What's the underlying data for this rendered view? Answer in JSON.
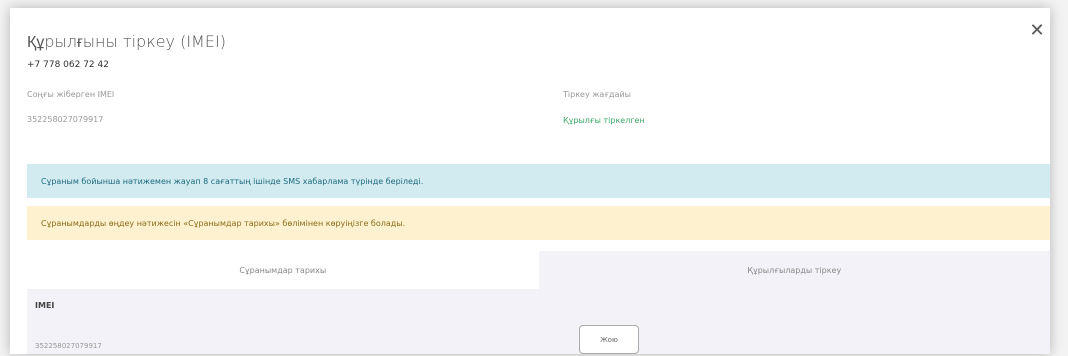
{
  "modal": {
    "title": "Құрылғыны тіркеу (IMEI)",
    "close_glyph": "✕",
    "phone": "+7 778 062 72 42"
  },
  "info": {
    "last_imei_label": "Соңғы жіберген IMEI",
    "last_imei_value": "352258027079917",
    "reg_status_label": "Тіркеу жағдайы",
    "reg_status_value": "Құрылғы тіркелген"
  },
  "alerts": {
    "info_text": "Сұраным бойынша нәтижемен жауап 8 сағаттың ішінде SMS хабарлама түрінде беріледі.",
    "warning_text": "Сұранымдарды өңдеу нәтижесін «Сұранымдар тарихы» бөлімінен көруіңізге болады."
  },
  "tabs": [
    {
      "label": "Сұранымдар тарихы",
      "active": false
    },
    {
      "label": "Құрылғыларды тіркеу",
      "active": true
    }
  ],
  "panel": {
    "imei_header": "IMEI",
    "imei_value": "352258027079917",
    "button_label": "Жою"
  },
  "colors": {
    "info_bg": "#d2ebf1",
    "warning_bg": "#fdf1cf",
    "link": "#3aa96a",
    "active_tab_bg": "#f3f2f8"
  }
}
